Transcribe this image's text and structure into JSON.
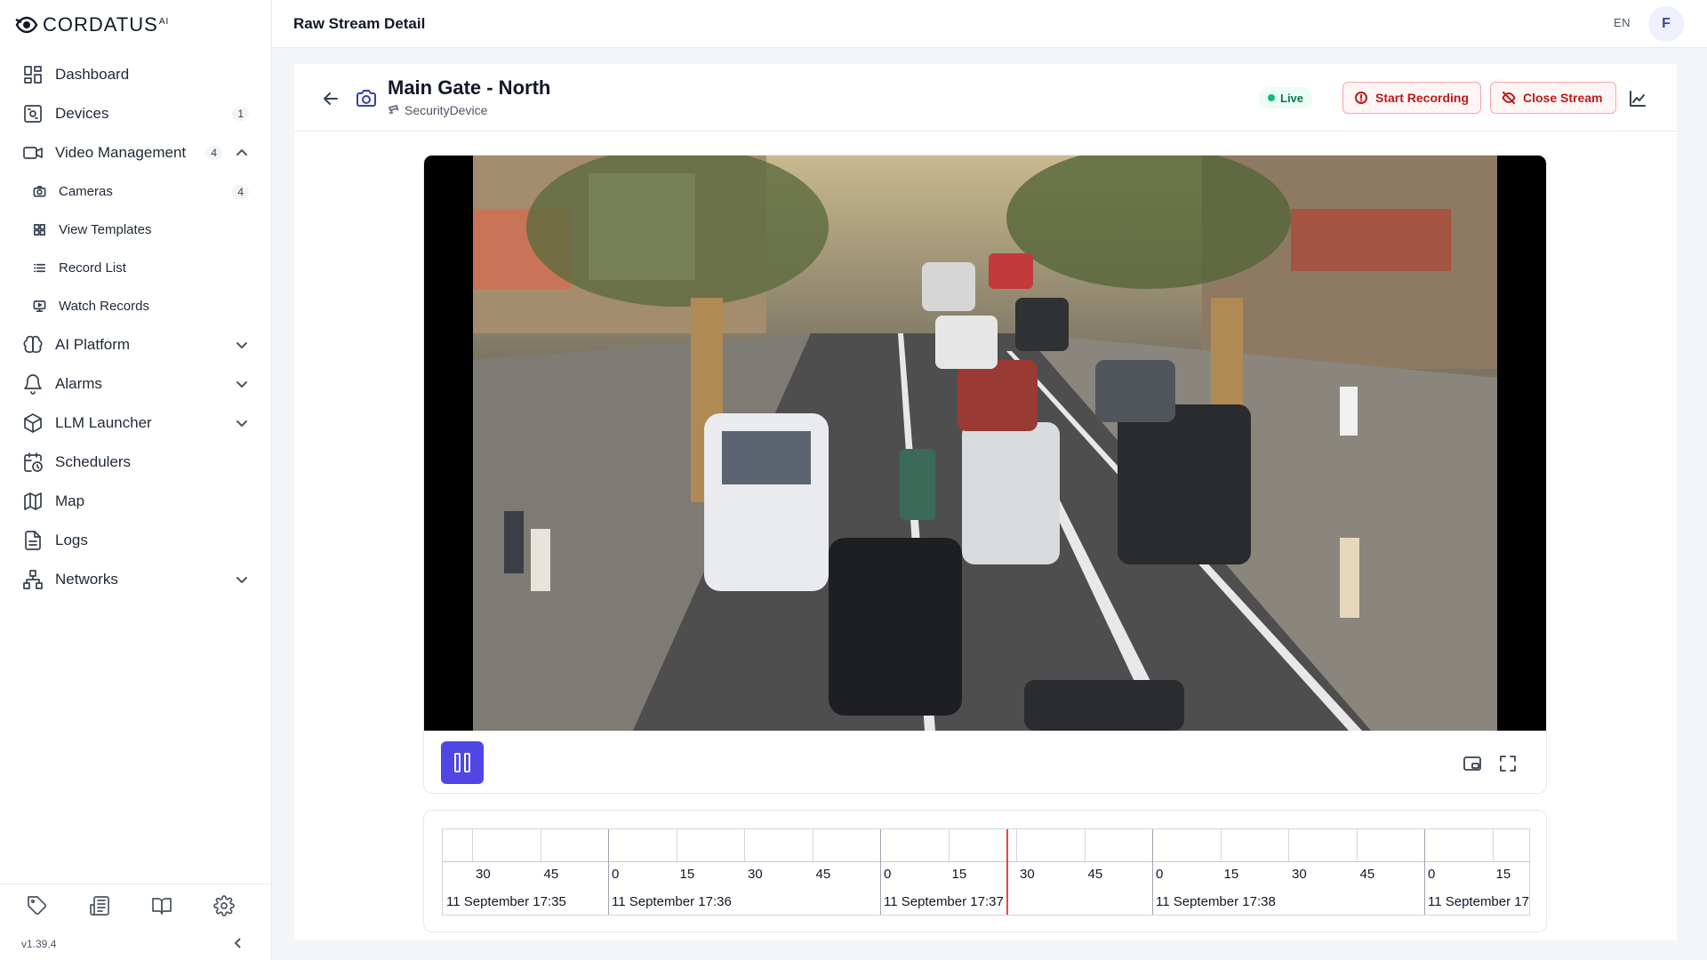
{
  "app": {
    "logo_text": "CORDATUS",
    "logo_sup": "AI",
    "page_title": "Raw Stream Detail",
    "language": "EN",
    "avatar_initial": "F",
    "version": "v1.39.4"
  },
  "sidebar": {
    "items": [
      {
        "label": "Dashboard",
        "icon": "dashboard-icon"
      },
      {
        "label": "Devices",
        "icon": "devices-icon",
        "badge": "1"
      },
      {
        "label": "Video Management",
        "icon": "video-icon",
        "badge": "4",
        "expanded": true
      },
      {
        "label": "AI Platform",
        "icon": "brain-icon",
        "collapsible": true
      },
      {
        "label": "Alarms",
        "icon": "bell-icon",
        "collapsible": true
      },
      {
        "label": "LLM Launcher",
        "icon": "box-icon",
        "collapsible": true
      },
      {
        "label": "Schedulers",
        "icon": "calendar-clock-icon"
      },
      {
        "label": "Map",
        "icon": "map-icon"
      },
      {
        "label": "Logs",
        "icon": "file-icon"
      },
      {
        "label": "Networks",
        "icon": "network-icon",
        "collapsible": true
      }
    ],
    "sub_items": [
      {
        "label": "Cameras",
        "icon": "camera-icon",
        "badge": "4"
      },
      {
        "label": "View Templates",
        "icon": "grid-icon"
      },
      {
        "label": "Record List",
        "icon": "list-icon"
      },
      {
        "label": "Watch Records",
        "icon": "monitor-play-icon"
      }
    ],
    "footer_icons": [
      "tag-icon",
      "newspaper-icon",
      "book-icon",
      "settings-icon"
    ]
  },
  "stream": {
    "name": "Main Gate - North",
    "device_type": "SecurityDevice",
    "status": "Live",
    "start_recording_label": "Start Recording",
    "close_stream_label": "Close Stream"
  },
  "colors": {
    "accent": "#4f46e5",
    "live": "#10b981",
    "danger": "#b91c1c",
    "playhead": "#ef4444"
  },
  "timeline": {
    "minor_labels": [
      "30",
      "45",
      "0",
      "15",
      "30",
      "45",
      "0",
      "15",
      "30",
      "45",
      "0",
      "15",
      "30",
      "45",
      "0",
      "15"
    ],
    "major_labels": [
      "11 September 17:35",
      "11 September 17:36",
      "11 September 17:37",
      "11 September 17:38",
      "11 September 17:"
    ],
    "playhead_time": "11 September 17:37:20"
  }
}
